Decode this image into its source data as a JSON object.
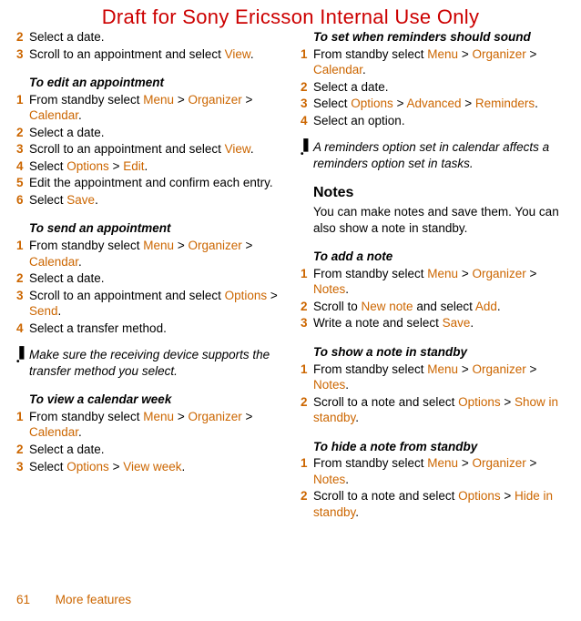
{
  "watermark": "Draft for Sony Ericsson Internal Use Only",
  "left": {
    "pre_steps": [
      {
        "num": "2",
        "parts": [
          {
            "t": "Select a date."
          }
        ]
      },
      {
        "num": "3",
        "parts": [
          {
            "t": "Scroll to an appointment and select "
          },
          {
            "t": "View",
            "link": true
          },
          {
            "t": "."
          }
        ]
      }
    ],
    "h1": "To edit an appointment",
    "s1": [
      {
        "num": "1",
        "parts": [
          {
            "t": "From standby select "
          },
          {
            "t": "Menu",
            "link": true
          },
          {
            "t": " > "
          },
          {
            "t": "Organizer",
            "link": true
          },
          {
            "t": " > "
          },
          {
            "t": "Calendar",
            "link": true
          },
          {
            "t": "."
          }
        ]
      },
      {
        "num": "2",
        "parts": [
          {
            "t": "Select a date."
          }
        ]
      },
      {
        "num": "3",
        "parts": [
          {
            "t": "Scroll to an appointment and select "
          },
          {
            "t": "View",
            "link": true
          },
          {
            "t": "."
          }
        ]
      },
      {
        "num": "4",
        "parts": [
          {
            "t": "Select "
          },
          {
            "t": "Options",
            "link": true
          },
          {
            "t": " > "
          },
          {
            "t": "Edit",
            "link": true
          },
          {
            "t": "."
          }
        ]
      },
      {
        "num": "5",
        "parts": [
          {
            "t": "Edit the appointment and confirm each entry."
          }
        ]
      },
      {
        "num": "6",
        "parts": [
          {
            "t": "Select "
          },
          {
            "t": "Save",
            "link": true
          },
          {
            "t": "."
          }
        ]
      }
    ],
    "h2": "To send an appointment",
    "s2": [
      {
        "num": "1",
        "parts": [
          {
            "t": "From standby select "
          },
          {
            "t": "Menu",
            "link": true
          },
          {
            "t": " > "
          },
          {
            "t": "Organizer",
            "link": true
          },
          {
            "t": " > "
          },
          {
            "t": "Calendar",
            "link": true
          },
          {
            "t": "."
          }
        ]
      },
      {
        "num": "2",
        "parts": [
          {
            "t": "Select a date."
          }
        ]
      },
      {
        "num": "3",
        "parts": [
          {
            "t": "Scroll to an appointment and select "
          },
          {
            "t": "Options",
            "link": true
          },
          {
            "t": " > "
          },
          {
            "t": "Send",
            "link": true
          },
          {
            "t": "."
          }
        ]
      },
      {
        "num": "4",
        "parts": [
          {
            "t": "Select a transfer method."
          }
        ]
      }
    ],
    "note1": "Make sure the receiving device supports the transfer method you select.",
    "h3": "To view a calendar week",
    "s3": [
      {
        "num": "1",
        "parts": [
          {
            "t": "From standby select "
          },
          {
            "t": "Menu",
            "link": true
          },
          {
            "t": " > "
          },
          {
            "t": "Organizer",
            "link": true
          },
          {
            "t": " > "
          },
          {
            "t": "Calendar",
            "link": true
          },
          {
            "t": "."
          }
        ]
      },
      {
        "num": "2",
        "parts": [
          {
            "t": "Select a date."
          }
        ]
      },
      {
        "num": "3",
        "parts": [
          {
            "t": "Select "
          },
          {
            "t": "Options",
            "link": true
          },
          {
            "t": " > "
          },
          {
            "t": "View week",
            "link": true
          },
          {
            "t": "."
          }
        ]
      }
    ]
  },
  "right": {
    "h1": "To set when reminders should sound",
    "s1": [
      {
        "num": "1",
        "parts": [
          {
            "t": "From standby select "
          },
          {
            "t": "Menu",
            "link": true
          },
          {
            "t": " > "
          },
          {
            "t": "Organizer",
            "link": true
          },
          {
            "t": " > "
          },
          {
            "t": "Calendar",
            "link": true
          },
          {
            "t": "."
          }
        ]
      },
      {
        "num": "2",
        "parts": [
          {
            "t": "Select a date."
          }
        ]
      },
      {
        "num": "3",
        "parts": [
          {
            "t": "Select "
          },
          {
            "t": "Options",
            "link": true
          },
          {
            "t": " > "
          },
          {
            "t": "Advanced",
            "link": true
          },
          {
            "t": " > "
          },
          {
            "t": "Reminders",
            "link": true
          },
          {
            "t": "."
          }
        ]
      },
      {
        "num": "4",
        "parts": [
          {
            "t": "Select an option."
          }
        ]
      }
    ],
    "note1": "A reminders option set in calendar affects a reminders option set in tasks.",
    "section": "Notes",
    "intro": "You can make notes and save them. You can also show a note in standby.",
    "h2": "To add a note",
    "s2": [
      {
        "num": "1",
        "parts": [
          {
            "t": "From standby select "
          },
          {
            "t": "Menu",
            "link": true
          },
          {
            "t": " > "
          },
          {
            "t": "Organizer",
            "link": true
          },
          {
            "t": " > "
          },
          {
            "t": "Notes",
            "link": true
          },
          {
            "t": "."
          }
        ]
      },
      {
        "num": "2",
        "parts": [
          {
            "t": "Scroll to "
          },
          {
            "t": "New note",
            "link": true
          },
          {
            "t": " and select "
          },
          {
            "t": "Add",
            "link": true
          },
          {
            "t": "."
          }
        ]
      },
      {
        "num": "3",
        "parts": [
          {
            "t": "Write a note and select "
          },
          {
            "t": "Save",
            "link": true
          },
          {
            "t": "."
          }
        ]
      }
    ],
    "h3": "To show a note in standby",
    "s3": [
      {
        "num": "1",
        "parts": [
          {
            "t": "From standby select "
          },
          {
            "t": "Menu",
            "link": true
          },
          {
            "t": " > "
          },
          {
            "t": "Organizer",
            "link": true
          },
          {
            "t": " > "
          },
          {
            "t": "Notes",
            "link": true
          },
          {
            "t": "."
          }
        ]
      },
      {
        "num": "2",
        "parts": [
          {
            "t": "Scroll to a note and select "
          },
          {
            "t": "Options",
            "link": true
          },
          {
            "t": " > "
          },
          {
            "t": "Show in standby",
            "link": true
          },
          {
            "t": "."
          }
        ]
      }
    ],
    "h4": "To hide a note from standby",
    "s4": [
      {
        "num": "1",
        "parts": [
          {
            "t": "From standby select "
          },
          {
            "t": "Menu",
            "link": true
          },
          {
            "t": " > "
          },
          {
            "t": "Organizer",
            "link": true
          },
          {
            "t": " > "
          },
          {
            "t": "Notes",
            "link": true
          },
          {
            "t": "."
          }
        ]
      },
      {
        "num": "2",
        "parts": [
          {
            "t": "Scroll to a note and select "
          },
          {
            "t": "Options",
            "link": true
          },
          {
            "t": " > "
          },
          {
            "t": "Hide in standby",
            "link": true
          },
          {
            "t": "."
          }
        ]
      }
    ]
  },
  "footer": {
    "page": "61",
    "section": "More features"
  }
}
